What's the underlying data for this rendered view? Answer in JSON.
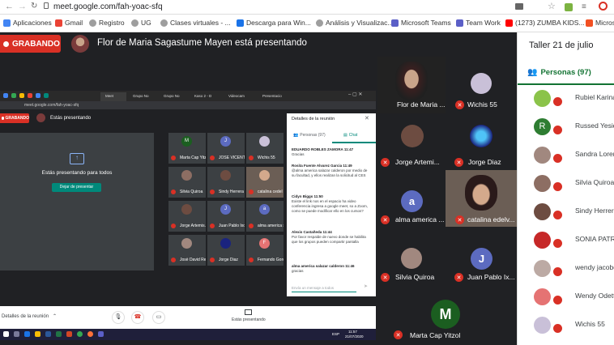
{
  "browser": {
    "url": "meet.google.com/fah-yoac-sfq"
  },
  "bookmarks": [
    {
      "label": "Aplicaciones",
      "color": "#4285f4"
    },
    {
      "label": "Gmail",
      "color": "#ea4335"
    },
    {
      "label": "Registro",
      "color": "#9e9e9e"
    },
    {
      "label": "UG",
      "color": "#9e9e9e"
    },
    {
      "label": "Clases virtuales - ...",
      "color": "#9e9e9e"
    },
    {
      "label": "Descarga para Win...",
      "color": "#1a73e8"
    },
    {
      "label": "Análisis y Visualizac...",
      "color": "#9e9e9e"
    },
    {
      "label": "Microsoft Teams",
      "color": "#5b5fc7"
    },
    {
      "label": "Team Work",
      "color": "#5b5fc7"
    },
    {
      "label": "(1273) ZUMBA KIDS...",
      "color": "#ff0000"
    },
    {
      "label": "Microso",
      "color": "#f25022"
    }
  ],
  "meeting": {
    "recording": "GRABANDO",
    "presenter": "Flor de Maria Sagastume Mayen está presentando"
  },
  "tiles": [
    {
      "name": "Flor de Maria ...",
      "muted": false
    },
    {
      "name": "Wichis 55",
      "muted": true
    },
    {
      "name": "Jorge Artemi...",
      "muted": true
    },
    {
      "name": "Jorge Diaz",
      "muted": true
    },
    {
      "name": "alma america ...",
      "initial": "a",
      "muted": true
    },
    {
      "name": "catalina edelv...",
      "muted": true
    },
    {
      "name": "Silvia Quiroa",
      "muted": true
    },
    {
      "name": "Juan Pablo Ix...",
      "initial": "J",
      "muted": true
    },
    {
      "name": "Marta Cap Yitzol",
      "initial": "M",
      "muted": true
    }
  ],
  "panel": {
    "title": "Taller 21 de julio",
    "people_tab": "Personas (97)",
    "people": [
      "Rubiel Karina",
      "Russed Yesid",
      "Sandra Lorena",
      "Silvia Quiroa",
      "Sindy Herrera",
      "SONIA PATRICI",
      "wendy jacobo",
      "Wendy Odette",
      "Wichis 55"
    ],
    "initials": {
      "Russed Yesid": "R"
    }
  },
  "shared": {
    "url": "meet.google.com/fah-yoac-sfq",
    "tabs": [
      "Meet",
      "Grupo No",
      "Grupo No",
      "Kaso 2 - D",
      "Videocam",
      "Presentacio"
    ],
    "recording": "GRABANDO",
    "presenting_you": "Estás presentando",
    "presenting_all": "Estás presentando para todos",
    "stop_button": "Dejar de presentar",
    "details": "Detalles de la reunión",
    "presenting_bottom": "Estás presentando",
    "grid": [
      {
        "name": "Marta Cap Yitzol",
        "initial": "M"
      },
      {
        "name": "JOSE VICENTE ...",
        "initial": "J"
      },
      {
        "name": "Wichis 55"
      },
      {
        "name": "Silvia Quiroa"
      },
      {
        "name": "Sindy Herrera"
      },
      {
        "name": "catalina cedel"
      },
      {
        "name": "Jorge Artemis..."
      },
      {
        "name": "Juan Pablo Ixc...",
        "initial": "J"
      },
      {
        "name": "alma america s...",
        "initial": "a"
      },
      {
        "name": "Josè David Rey..."
      },
      {
        "name": "Jorge Diaz"
      },
      {
        "name": "Fernando Gordi...",
        "initial": "F"
      }
    ],
    "chat": {
      "header": "Detalles de la reunión",
      "tab_people": "Personas (97)",
      "tab_chat": "Chat",
      "messages": [
        {
          "author": "EDUARDO ROBLES ZAMORA 11:47",
          "text": "Gracias"
        },
        {
          "author": "Rosita Fuente Alvarez Garcia 11:49",
          "text": "@alma america salazar calderon por medio de su facultad, y ellos realizan la solicitud al CES"
        },
        {
          "author": "Cidyn Biggs 11:50",
          "text": "Existe el link nos en el espacio ha video conferencia ingresa a google meet, so a Zoom, como se puede modificar ello en los cursos?"
        },
        {
          "author": "Alexis Castañeda 11:44",
          "text": "Por favor respalde de nuevo donde se habilita que los grupos pueden compartir pantalla"
        },
        {
          "author": "alma america salazar calderon 11:46",
          "text": "gracias"
        }
      ],
      "input_placeholder": "Envía un mensaje a todos"
    },
    "taskbar": {
      "clock": "11:57",
      "date": "21/07/2020",
      "lang": "ESP"
    }
  },
  "colors": {
    "record": "#d93025",
    "accent": "#1a73e8",
    "green": "#137333",
    "teal": "#00897b",
    "muted": "#d93025"
  }
}
